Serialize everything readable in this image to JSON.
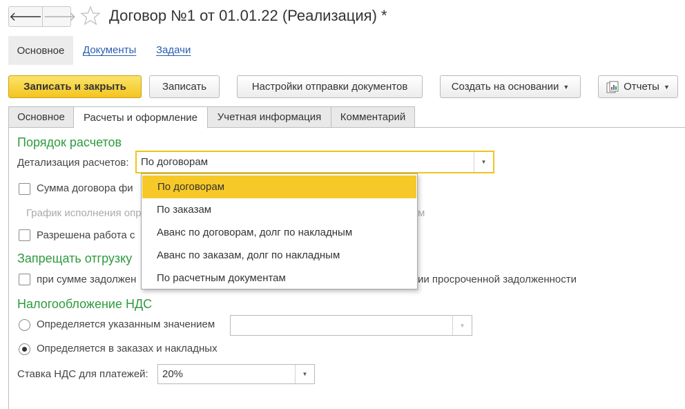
{
  "window": {
    "title": "Договор №1 от 01.01.22 (Реализация) *",
    "nav_back_glyph": "🡐",
    "nav_forward_glyph": "🡒"
  },
  "top_tabs": {
    "main": "Основное",
    "documents": "Документы",
    "tasks": "Задачи"
  },
  "toolbar": {
    "save_close": "Записать и закрыть",
    "save": "Записать",
    "send_settings": "Настройки отправки документов",
    "create_based_on": "Создать на основании",
    "reports": "Отчеты"
  },
  "form_tabs": [
    "Основное",
    "Расчеты и оформление",
    "Учетная информация",
    "Комментарий"
  ],
  "payments": {
    "section_title": "Порядок расчетов",
    "detail_label": "Детализация расчетов:",
    "detail_value": "По договорам",
    "fixed_sum_label": "Сумма договора фи",
    "schedule_label": "График исполнения опр",
    "schedule_label_tail": "м",
    "allowed_work_label": "Разрешена работа с"
  },
  "shipment": {
    "section_title": "Запрещать отгрузку",
    "debt_label": "при сумме задолжен",
    "debt_label_tail": "ии просроченной задолженности"
  },
  "vat": {
    "section_title": "Налогообложение НДС",
    "option_specified": "Определяется указанным значением",
    "option_orders": "Определяется в заказах и накладных",
    "selected_option": "option_orders",
    "rate_label": "Ставка НДС для платежей:",
    "rate_value": "20%",
    "specified_value": ""
  },
  "dropdown": {
    "options": [
      "По договорам",
      "По заказам",
      "Аванс по договорам, долг по накладным",
      "Аванс по заказам, долг по накладным",
      "По расчетным документам"
    ],
    "selected_index": 0
  },
  "colors": {
    "accent_yellow": "#f7c928",
    "section_green": "#2e9a3e",
    "link_blue": "#2a5db0"
  }
}
